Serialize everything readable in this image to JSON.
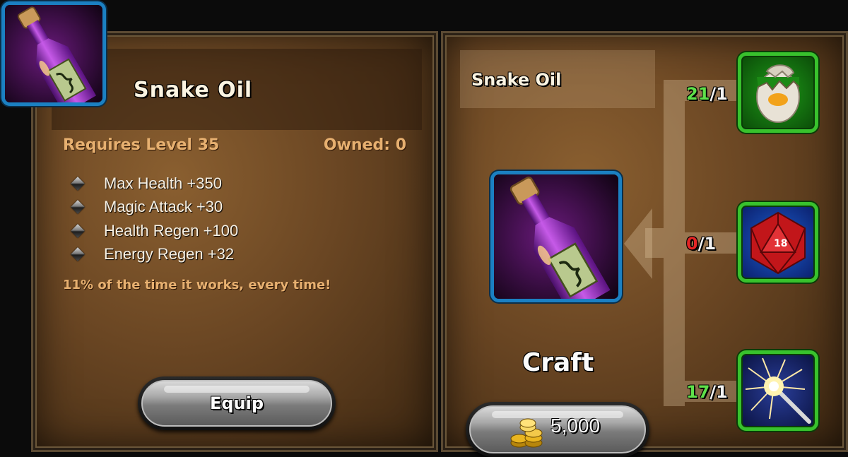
{
  "item": {
    "title": "Snake Oil",
    "requires": "Requires Level 35",
    "owned": "Owned: 0",
    "stats": [
      "Max Health +350",
      "Magic Attack +30",
      "Health Regen +100",
      "Energy Regen +32"
    ],
    "flavor": "11% of the time it works, every time!",
    "equip_label": "Equip",
    "icon": "potion-bottle-icon"
  },
  "recipe": {
    "name": "Snake Oil",
    "craft_label": "Craft",
    "cost": "5,000",
    "cost_icon": "gold-coins-icon",
    "ingredients": [
      {
        "icon": "cracked-egg-icon",
        "have": "21",
        "need": "1",
        "have_color": "#5ee04a"
      },
      {
        "icon": "red-d20-dice-icon",
        "have": "0",
        "need": "1",
        "have_color": "#e42525"
      },
      {
        "icon": "sparkler-icon",
        "have": "17",
        "need": "1",
        "have_color": "#5ee04a"
      }
    ]
  },
  "colors": {
    "icon_frame_blue": "#1b80c2",
    "ingredient_frame_green": "#38c22d",
    "text_gold": "#e7b070"
  }
}
